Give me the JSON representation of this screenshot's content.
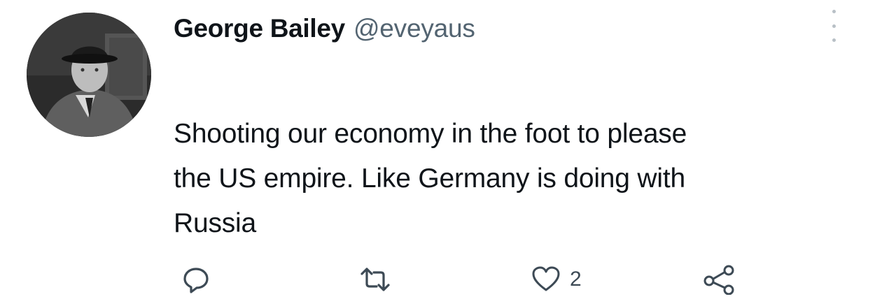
{
  "tweet": {
    "author": {
      "display_name": "George Bailey",
      "handle": "@eveyaus",
      "avatar_icon": "profile-photo"
    },
    "text": "Shooting our economy in the foot to please\nthe US empire. Like Germany is doing with\nRussia",
    "menu_icon": "more-vertical-icon",
    "actions": {
      "reply_icon": "reply-icon",
      "retweet_icon": "retweet-icon",
      "like_icon": "heart-icon",
      "like_count": "2",
      "share_icon": "share-icon"
    }
  },
  "colors": {
    "text_primary": "#0f1419",
    "text_secondary": "#536471",
    "icon": "#3d4a55"
  }
}
